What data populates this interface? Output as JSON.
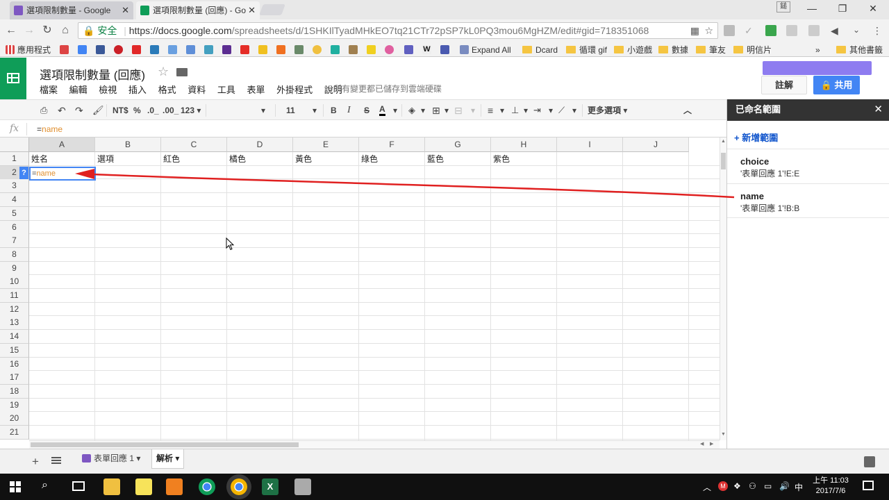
{
  "browser": {
    "tabs": [
      {
        "title": "選項限制數量 - Google",
        "close": "✕"
      },
      {
        "title": "選項限制數量 (回應) - Go",
        "close": "✕"
      }
    ],
    "window_controls": {
      "minimize": "—",
      "restore": "❐",
      "close": "✕"
    },
    "user_badge": "鎚",
    "secure_label": "安全",
    "url_host": "https://docs.google.com",
    "url_path": "/spreadsheets/d/1SHKIlTyadMHkEO7tq21CTr72pSP7kL0PQ3mou6MgHZM/edit#gid=718351068",
    "bookmarks": [
      {
        "label": "應用程式",
        "icon": "apps-icon"
      },
      {
        "label": "Expand All",
        "icon": "star-bookmark-icon"
      },
      {
        "label": "Dcard",
        "icon": "folder-icon"
      },
      {
        "label": "循環 gif",
        "icon": "folder-icon"
      },
      {
        "label": "小遊戲",
        "icon": "folder-icon"
      },
      {
        "label": "數據",
        "icon": "folder-icon"
      },
      {
        "label": "筆友",
        "icon": "folder-icon"
      },
      {
        "label": "明信片",
        "icon": "folder-icon"
      },
      {
        "label": "»",
        "icon": ""
      },
      {
        "label": "其他書籤",
        "icon": "folder-icon"
      }
    ]
  },
  "doc": {
    "title": "選項限制數量 (回應)",
    "menu": [
      "檔案",
      "編輯",
      "檢視",
      "插入",
      "格式",
      "資料",
      "工具",
      "表單",
      "外掛程式",
      "說明"
    ],
    "save_status": "所有變更都已儲存到雲端硬碟",
    "comments_label": "註解",
    "share_label": "🔒 共用"
  },
  "toolbar": {
    "currency": "NT$",
    "percent": "%",
    "dec_less": ".0_",
    "dec_more": ".00_",
    "number_format": "123 ▾",
    "font_size": "11",
    "bold": "B",
    "italic": "I",
    "strike": "S",
    "text_color": "A",
    "more": "更多選項 ▾",
    "collapse": "︿"
  },
  "formula_bar": {
    "fx": "fx",
    "eq": "=",
    "ref": "name"
  },
  "grid": {
    "columns": [
      "A",
      "B",
      "C",
      "D",
      "E",
      "F",
      "G",
      "H",
      "I",
      "J"
    ],
    "rows": [
      "1",
      "2",
      "3",
      "4",
      "5",
      "6",
      "7",
      "8",
      "9",
      "10",
      "11",
      "12",
      "13",
      "14",
      "15",
      "16",
      "17",
      "18",
      "19",
      "20",
      "21"
    ],
    "header_row": [
      "姓名",
      "選項",
      "紅色",
      "橘色",
      "黃色",
      "綠色",
      "藍色",
      "紫色"
    ],
    "active_cell_eq": "=",
    "active_cell_ref": "name",
    "help_badge": "?"
  },
  "sheet_tabs": [
    {
      "label": "表單回應 1 ▾"
    },
    {
      "label": "解析 ▾"
    }
  ],
  "named_ranges": {
    "title": "已命名範圍",
    "close": "✕",
    "add_label": "+ 新增範圍",
    "items": [
      {
        "name": "choice",
        "ref": "'表單回應 1'!E:E"
      },
      {
        "name": "name",
        "ref": "'表單回應 1'!B:B"
      }
    ]
  },
  "taskbar": {
    "clock_time": "上午 11:03",
    "clock_date": "2017/7/6",
    "ime": "中"
  },
  "colors": {
    "sheets_green": "#0f9d58",
    "share_blue": "#4285f4",
    "arrow_red": "#e02020",
    "formula_orange": "#e08f2f"
  }
}
